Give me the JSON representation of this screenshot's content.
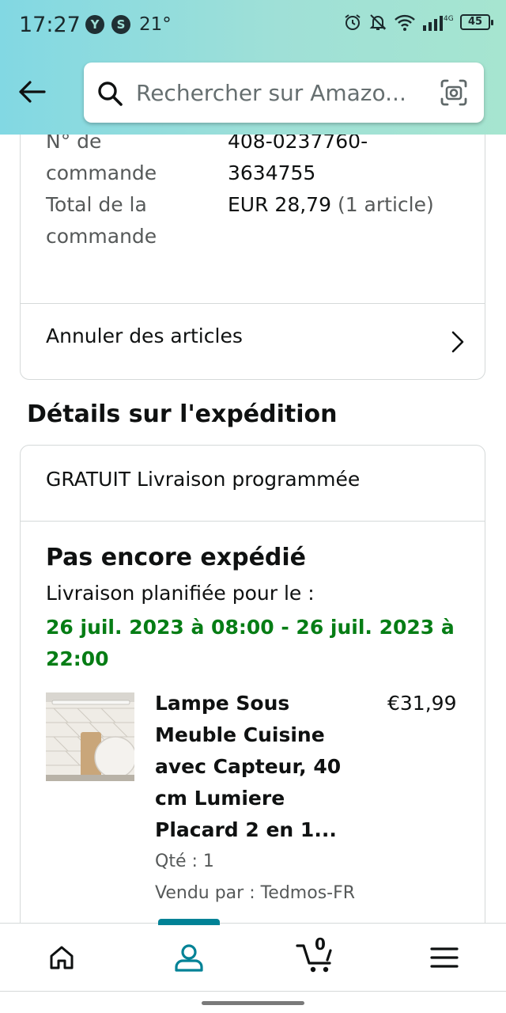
{
  "status_bar": {
    "time": "17:27",
    "app_badge_1": "Y",
    "app_badge_2": "S",
    "temperature": "21°",
    "network": "4G",
    "battery": "45"
  },
  "header": {
    "search": {
      "placeholder": "Rechercher sur Amazo..."
    },
    "colors": {
      "gradient_start": "#82d8e3",
      "gradient_end": "#a6e5d0"
    }
  },
  "order_summary": {
    "top_cut_label": "commande",
    "order_number_label_1": "N° de",
    "order_number_label_2": "commande",
    "order_number_1": "408-0237760-",
    "order_number_2": "3634755",
    "total_label_1": "Total de la",
    "total_label_2": "commande",
    "total_value": "EUR 28,79",
    "total_items": "(1 article)",
    "cancel_label": "Annuler des articles"
  },
  "shipment": {
    "section_title": "Détails sur l'expédition",
    "shipping_type": "GRATUIT Livraison programmée",
    "status": "Pas encore expédié",
    "delivery_label": "Livraison planifiée pour le :",
    "delivery_window": "26 juil. 2023 à 08:00 - 26 juil. 2023 à 22:00",
    "delivery_color": "#067d15",
    "product": {
      "title": "Lampe Sous Meuble Cuisine avec Capteur, 40 cm Lumiere Placard 2 en 1...",
      "price": "€31,99",
      "qty": "Qté : 1",
      "seller": "Vendu par : Tedmos-FR"
    }
  },
  "bottom_nav": {
    "items": [
      "home-icon",
      "account-icon",
      "cart-icon",
      "menu-icon"
    ],
    "active": "account-icon",
    "cart_count": "0",
    "accent_color": "#008296"
  }
}
